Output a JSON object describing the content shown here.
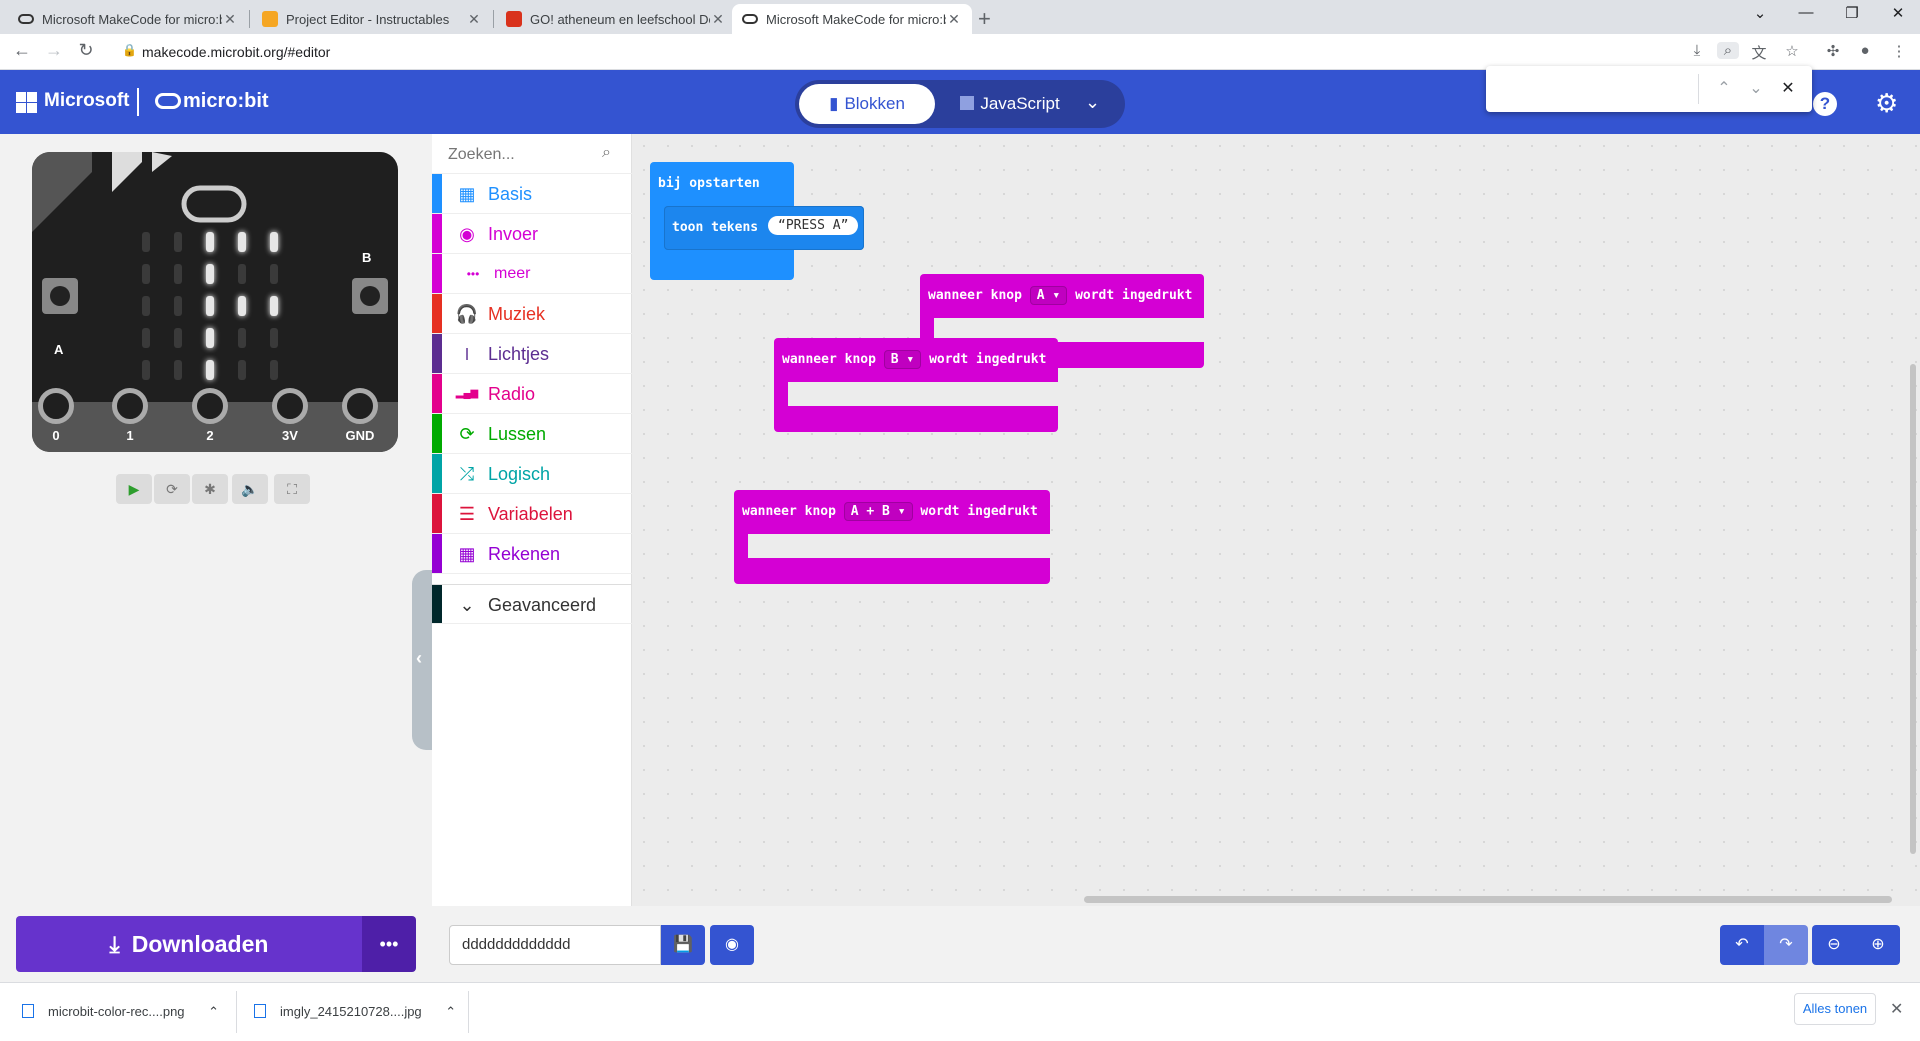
{
  "browser": {
    "tabs": [
      {
        "title": "Microsoft MakeCode for micro:bi",
        "active": false
      },
      {
        "title": "Project Editor - Instructables",
        "active": false
      },
      {
        "title": "GO! atheneum en leefschool De",
        "active": false
      },
      {
        "title": "Microsoft MakeCode for micro:bi",
        "active": true
      }
    ],
    "url": "makecode.microbit.org/#editor"
  },
  "header": {
    "microsoft_label": "Microsoft",
    "brand_label": "micro:bit",
    "mode_blocks": "Blokken",
    "mode_js": "JavaScript"
  },
  "simulator": {
    "pins": [
      "0",
      "1",
      "2",
      "3V",
      "GND"
    ],
    "button_a": "A",
    "button_b": "B",
    "led_grid": [
      [
        0,
        0,
        1,
        1,
        1
      ],
      [
        0,
        0,
        1,
        0,
        0
      ],
      [
        0,
        0,
        1,
        1,
        1
      ],
      [
        0,
        0,
        1,
        0,
        0
      ],
      [
        0,
        0,
        1,
        0,
        0
      ]
    ]
  },
  "toolbox": {
    "search_placeholder": "Zoeken...",
    "categories": [
      {
        "label": "Basis",
        "color": "#1e90ff",
        "icon": "grid-icon"
      },
      {
        "label": "Invoer",
        "color": "#d400d4",
        "icon": "target-icon"
      },
      {
        "label": "meer",
        "color": "#d400d4",
        "icon": "more-icon"
      },
      {
        "label": "Muziek",
        "color": "#e63022",
        "icon": "headphones-icon"
      },
      {
        "label": "Lichtjes",
        "color": "#5c2d91",
        "icon": "toggle-icon"
      },
      {
        "label": "Radio",
        "color": "#e3008c",
        "icon": "signal-icon"
      },
      {
        "label": "Lussen",
        "color": "#00aa00",
        "icon": "loop-icon"
      },
      {
        "label": "Logisch",
        "color": "#00a4a6",
        "icon": "shuffle-icon"
      },
      {
        "label": "Variabelen",
        "color": "#dc143c",
        "icon": "list-icon"
      },
      {
        "label": "Rekenen",
        "color": "#9400d3",
        "icon": "calculator-icon"
      },
      {
        "label": "Geavanceerd",
        "color": "#00272b",
        "icon": "chevron-down-icon"
      }
    ]
  },
  "workspace": {
    "on_start": {
      "label": "bij opstarten",
      "inner": "toon tekens",
      "text": "PRESS A"
    },
    "button_blocks": [
      {
        "prefix": "wanneer knop",
        "button": "A",
        "suffix": "wordt ingedrukt"
      },
      {
        "prefix": "wanneer knop",
        "button": "B",
        "suffix": "wordt ingedrukt"
      },
      {
        "prefix": "wanneer knop",
        "button": "A + B",
        "suffix": "wordt ingedrukt"
      }
    ]
  },
  "toolbar": {
    "download_label": "Downloaden",
    "project_name": "ddddddddddddd"
  },
  "downloads": {
    "items": [
      "microbit-color-rec....png",
      "imgly_2415210728....jpg"
    ],
    "show_all": "Alles tonen"
  }
}
